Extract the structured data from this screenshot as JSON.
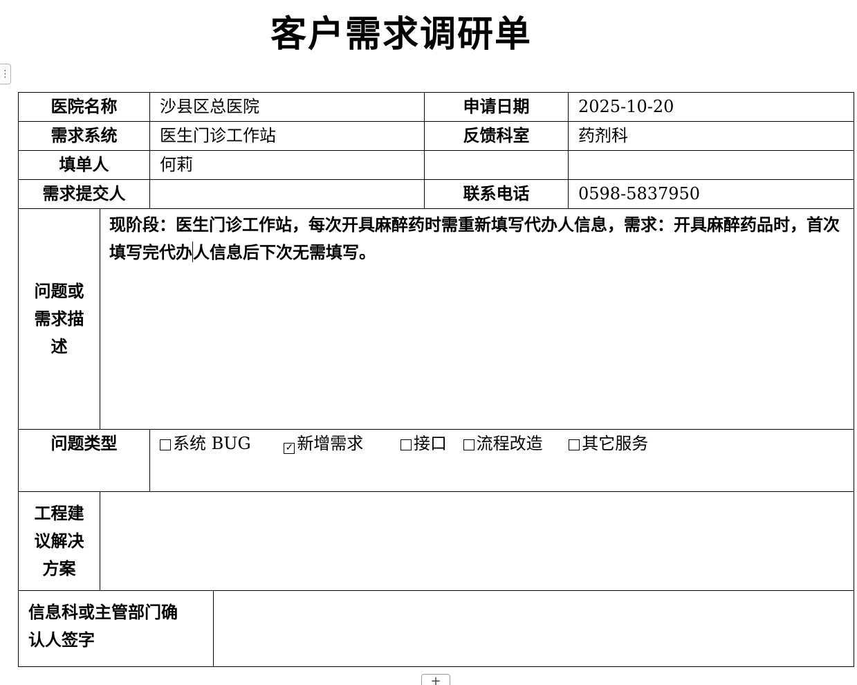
{
  "title": "客户需求调研单",
  "ui": {
    "row_handle_icon": "⋮",
    "add_row_icon": "+"
  },
  "fields": {
    "hospital_name_label": "医院名称",
    "hospital_name": "沙县区总医院",
    "apply_date_label": "申请日期",
    "apply_date": "2025-10-20",
    "system_label": "需求系统",
    "system": "医生门诊工作站",
    "department_label": "反馈科室",
    "department": "药剂科",
    "filler_label": "填单人",
    "filler": "何莉",
    "submitter_label": "需求提交人",
    "submitter": "",
    "phone_label": "联系电话",
    "phone": "0598-5837950"
  },
  "description": {
    "label_lines": [
      "问题或",
      "需求描",
      "述"
    ],
    "text_before_cursor": "现阶段：医生门诊工作站，每次开具麻醉药时需重新填写代办人信息，需求：开具麻醉药品时，首次填写完代办",
    "text_after_cursor": "人信息后下次无需填写。"
  },
  "issue_type": {
    "label": "问题类型",
    "options": [
      {
        "label": "系统 BUG",
        "checked": false
      },
      {
        "label": "新增需求",
        "checked": true
      },
      {
        "label": "接口",
        "checked": false
      },
      {
        "label": "流程改造",
        "checked": false
      },
      {
        "label": "其它服务",
        "checked": false
      }
    ]
  },
  "solution": {
    "label_lines": [
      "工程建",
      "议解决",
      "方案"
    ],
    "content": ""
  },
  "signature": {
    "label_lines": [
      "信息科或主管部门确",
      "认人签字"
    ],
    "content": ""
  }
}
